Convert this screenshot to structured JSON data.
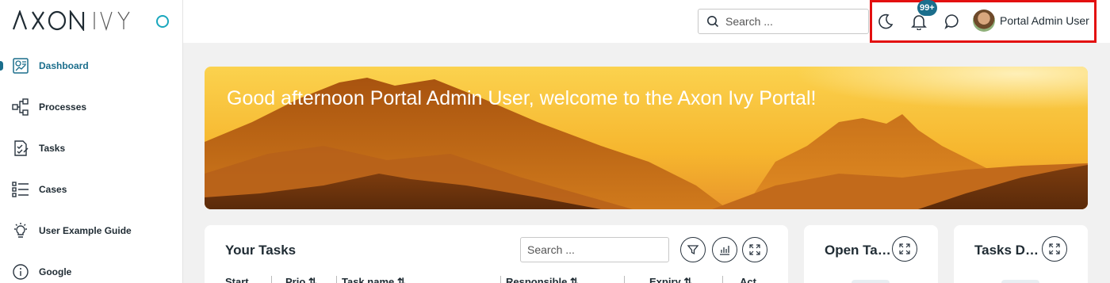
{
  "brand": {
    "logo_text": "AXONIVY"
  },
  "sidebar": {
    "items": [
      {
        "label": "Dashboard",
        "icon": "dashboard-icon",
        "active": true
      },
      {
        "label": "Processes",
        "icon": "processes-icon"
      },
      {
        "label": "Tasks",
        "icon": "tasks-icon"
      },
      {
        "label": "Cases",
        "icon": "cases-icon"
      },
      {
        "label": "User Example Guide",
        "icon": "lightbulb-icon"
      },
      {
        "label": "Google",
        "icon": "info-icon"
      }
    ]
  },
  "topbar": {
    "search_placeholder": "Search ...",
    "notification_badge": "99+",
    "user_name": "Portal Admin User",
    "icons": [
      "search-icon",
      "moon-icon",
      "bell-icon",
      "chat-icon",
      "avatar"
    ]
  },
  "banner": {
    "greeting": "Good afternoon Portal Admin User, welcome to the Axon Ivy Portal!"
  },
  "widgets": {
    "your_tasks": {
      "title": "Your Tasks",
      "search_placeholder": "Search ...",
      "columns": [
        "Start",
        "Prio",
        "Task name",
        "Responsible",
        "Expiry",
        "Act"
      ]
    },
    "open_tasks": {
      "title": "Open Tasks"
    },
    "tasks_done": {
      "title": "Tasks Done"
    }
  },
  "colors": {
    "accent": "#1b6e8c",
    "highlight_border": "#e31010",
    "toggle": "#19a7bd"
  }
}
